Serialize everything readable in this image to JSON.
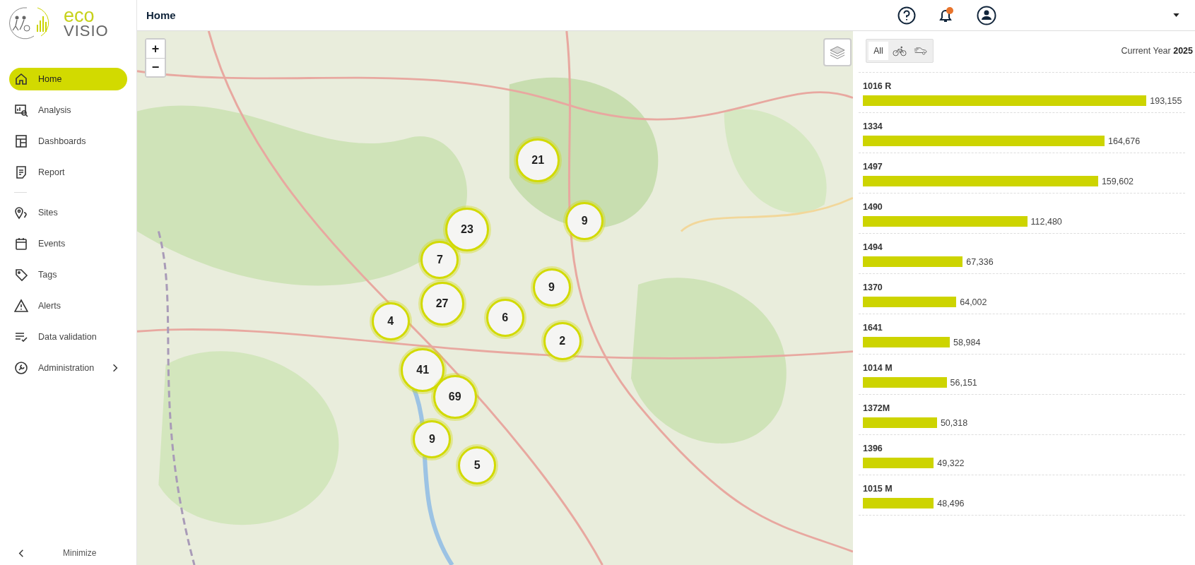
{
  "logo": {
    "line_1": "eco",
    "line_2": "VISIO"
  },
  "sidebar": {
    "items": [
      {
        "label": "Home",
        "kind": "home",
        "selected": true
      },
      {
        "label": "Analysis",
        "kind": "analysis",
        "selected": false
      },
      {
        "label": "Dashboards",
        "kind": "dashboard",
        "selected": false
      },
      {
        "label": "Report",
        "kind": "report",
        "selected": false
      },
      {
        "label": "Sites",
        "kind": "sites",
        "selected": false,
        "divider_before": true
      },
      {
        "label": "Events",
        "kind": "events",
        "selected": false
      },
      {
        "label": "Tags",
        "kind": "tags",
        "selected": false
      },
      {
        "label": "Alerts",
        "kind": "alerts",
        "selected": false
      },
      {
        "label": "Data validation",
        "kind": "validation",
        "selected": false
      },
      {
        "label": "Administration",
        "kind": "admin",
        "selected": false,
        "has_submenu": true
      }
    ],
    "minimize": "Minimize"
  },
  "header": {
    "title": "Home"
  },
  "map": {
    "zoom_in": "+",
    "zoom_out": "−",
    "clusters": [
      {
        "count": "21"
      },
      {
        "count": "9"
      },
      {
        "count": "23"
      },
      {
        "count": "7"
      },
      {
        "count": "9"
      },
      {
        "count": "27"
      },
      {
        "count": "6"
      },
      {
        "count": "4"
      },
      {
        "count": "2"
      },
      {
        "count": "41"
      },
      {
        "count": "69"
      },
      {
        "count": "9"
      },
      {
        "count": "5"
      }
    ]
  },
  "panel": {
    "filters": [
      {
        "kind": "text",
        "label": "All",
        "selected": true
      },
      {
        "kind": "bike",
        "selected": false
      },
      {
        "kind": "car",
        "selected": false
      }
    ],
    "period_label": "Current Year",
    "period_value": "2025",
    "rows": [
      {
        "name": "1016 R",
        "value": "193,155",
        "level": 0.88
      },
      {
        "name": "1334",
        "value": "164,676",
        "level": 0.75
      },
      {
        "name": "1497",
        "value": "159,602",
        "level": 0.73
      },
      {
        "name": "1490",
        "value": "112,480",
        "level": 0.51
      },
      {
        "name": "1494",
        "value": "67,336",
        "level": 0.31
      },
      {
        "name": "1370",
        "value": "64,002",
        "level": 0.29
      },
      {
        "name": "1641",
        "value": "58,984",
        "level": 0.27
      },
      {
        "name": "1014 M",
        "value": "56,151",
        "level": 0.26
      },
      {
        "name": "1372M",
        "value": "50,318",
        "level": 0.23
      },
      {
        "name": "1396",
        "value": "49,322",
        "level": 0.22
      },
      {
        "name": "1015 M",
        "value": "48,496",
        "level": 0.22
      }
    ]
  }
}
